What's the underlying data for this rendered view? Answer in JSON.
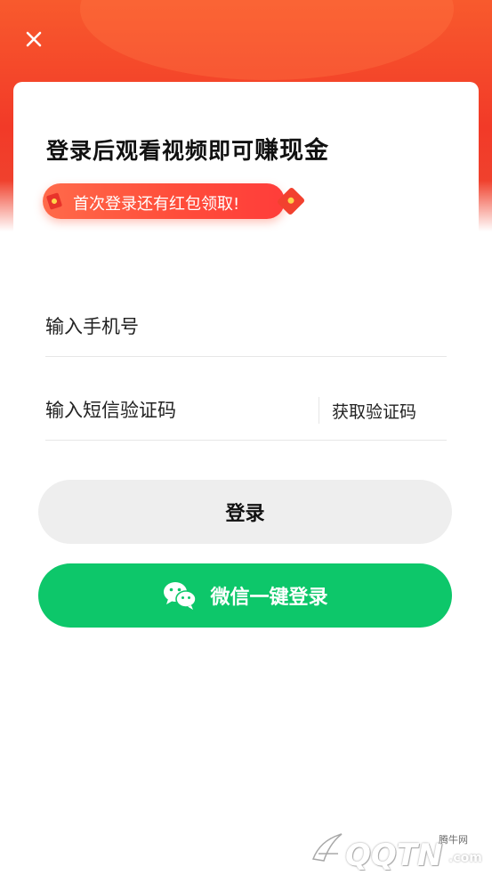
{
  "colors": {
    "header_red": "#f23a28",
    "promo_red": "#ff4d3a",
    "login_button_bg": "#eeeeee",
    "wechat_green": "#0dc76a"
  },
  "header": {
    "close_icon": "close-icon"
  },
  "card": {
    "headline_main": "登录后观看视频即可",
    "headline_highlight": "赚现金",
    "promo_text": "首次登录还有红包领取!"
  },
  "form": {
    "phone_placeholder": "输入手机号",
    "code_placeholder": "输入短信验证码",
    "get_code_label": "获取验证码",
    "login_label": "登录",
    "wechat_label": "微信一键登录",
    "wechat_icon": "wechat-icon"
  },
  "watermark": {
    "main": "QQTN",
    "small": "腾牛网",
    "suffix": ".com"
  }
}
